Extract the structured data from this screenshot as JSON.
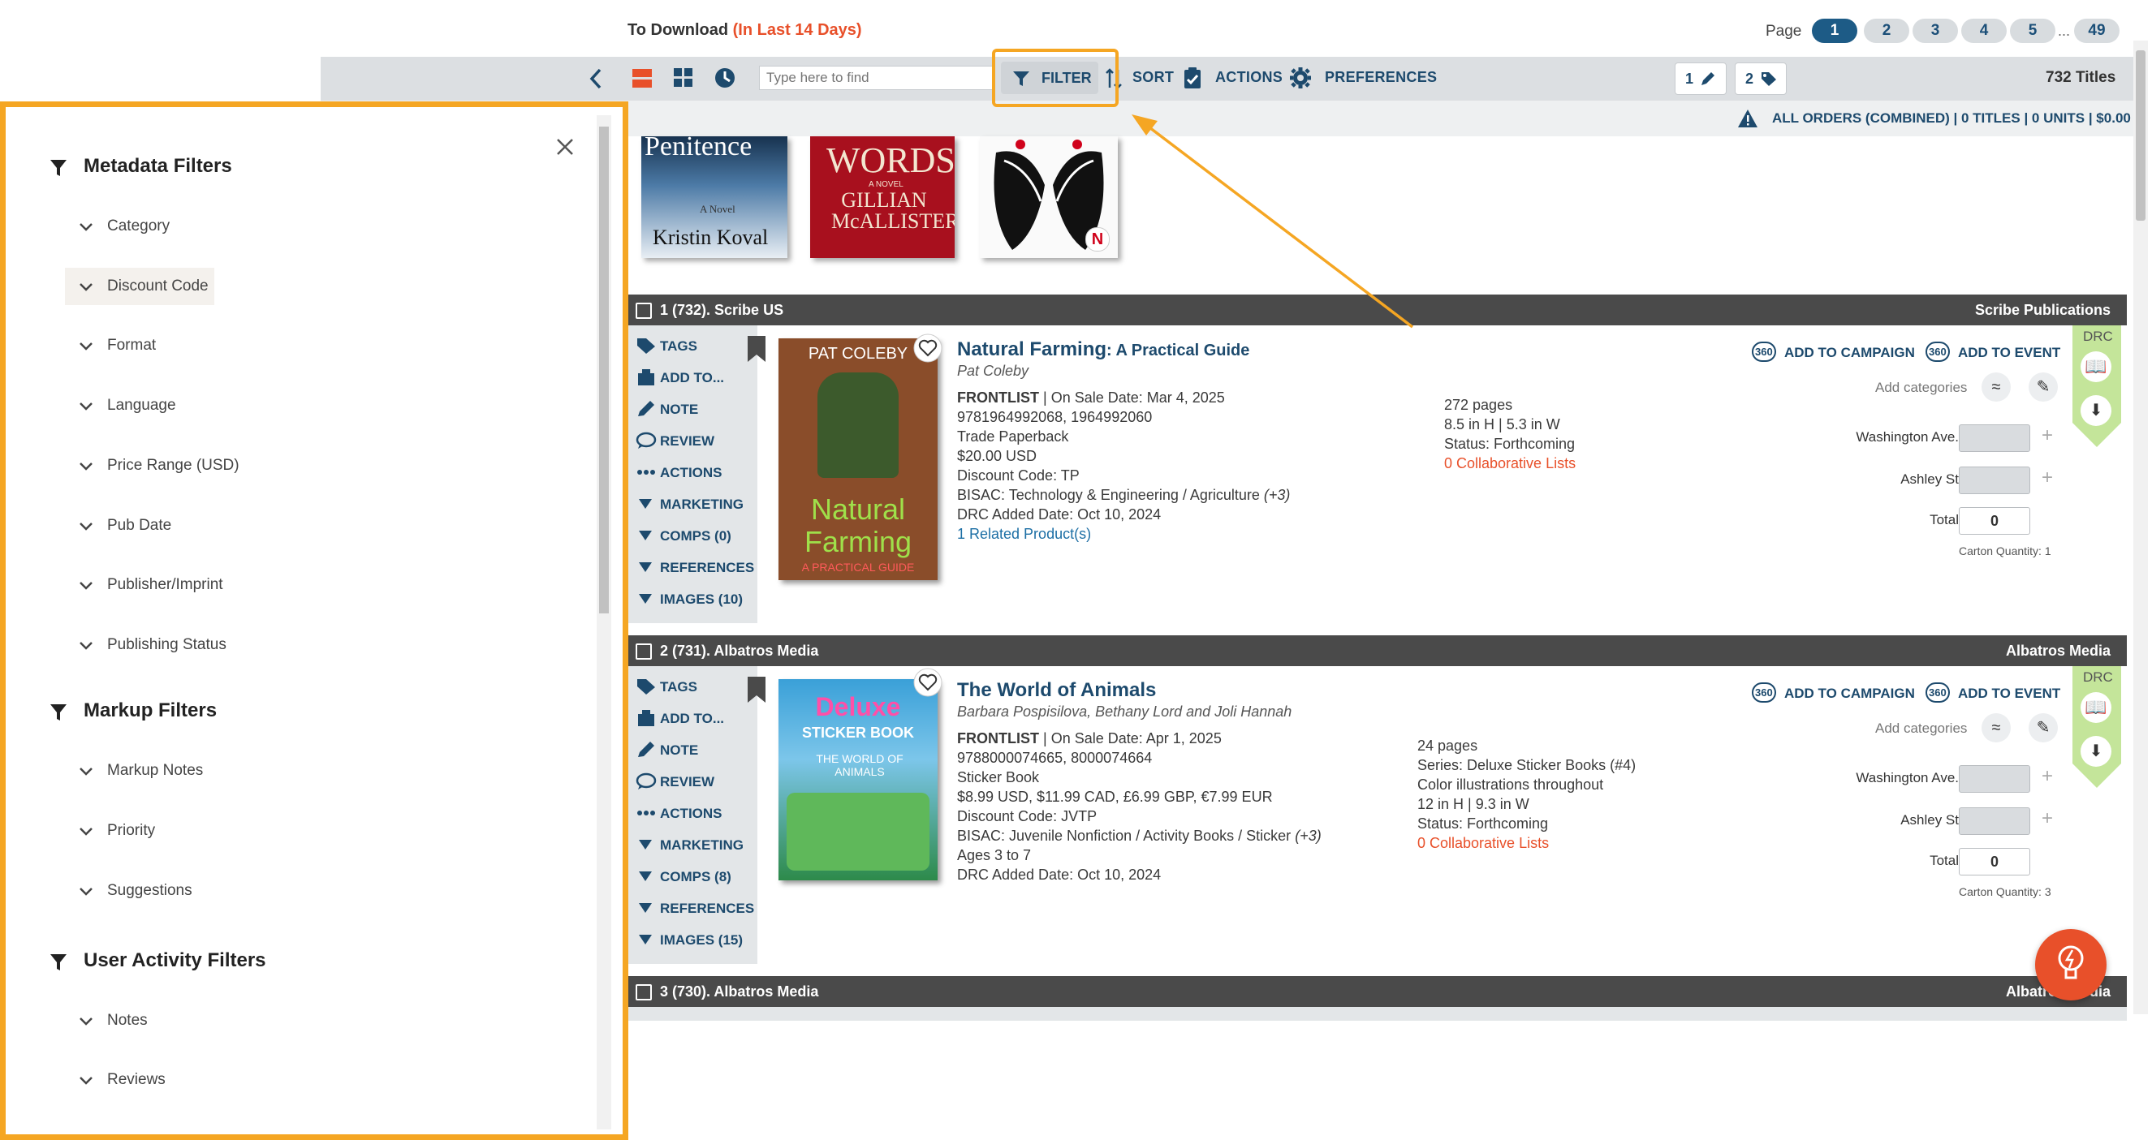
{
  "header": {
    "to_download": "To Download",
    "in_last": "(In Last 14 Days)",
    "page_label": "Page",
    "pages": [
      "1",
      "2",
      "3",
      "4",
      "5"
    ],
    "ellipsis": "...",
    "last_page": "49",
    "active_page": "1"
  },
  "toolbar": {
    "search_placeholder": "Type here to find",
    "filter": "FILTER",
    "sort": "SORT",
    "actions": "ACTIONS",
    "preferences": "PREFERENCES",
    "edit_count": "1",
    "tag_count": "2",
    "titles": "732 Titles"
  },
  "orders": {
    "text": "ALL ORDERS (COMBINED) | 0 TITLES | 0 UNITS | $0.00"
  },
  "filter_panel": {
    "metadata_title": "Metadata Filters",
    "metadata_items": [
      "Category",
      "Discount Code",
      "Format",
      "Language",
      "Price Range (USD)",
      "Pub Date",
      "Publisher/Imprint",
      "Publishing Status"
    ],
    "markup_title": "Markup Filters",
    "markup_items": [
      "Markup Notes",
      "Priority",
      "Suggestions"
    ],
    "activity_title": "User Activity Filters",
    "activity_items": [
      "Notes",
      "Reviews"
    ]
  },
  "carousel": {
    "covers": [
      {
        "title": "Penitence",
        "author": "Kristin Koval",
        "sub": "A Novel"
      },
      {
        "title": "WORDS",
        "author": "GILLIAN McALLISTER",
        "sub": "A NOVEL"
      },
      {
        "badge": "N"
      }
    ]
  },
  "side_actions": [
    "TAGS",
    "ADD TO...",
    "NOTE",
    "REVIEW",
    "ACTIONS",
    "MARKETING",
    "COMPS (0)",
    "REFERENCES",
    "IMAGES (10)"
  ],
  "side_actions_2": [
    "TAGS",
    "ADD TO...",
    "NOTE",
    "REVIEW",
    "ACTIONS",
    "MARKETING",
    "COMPS (8)",
    "REFERENCES",
    "IMAGES (15)"
  ],
  "titles": [
    {
      "header_left": "1 (732). Scribe US",
      "header_right": "Scribe Publications",
      "title": "Natural Farming",
      "subtitle": ": A Practical Guide",
      "author": "Pat Coleby",
      "cover_author": "PAT COLEBY",
      "cover_title1": "Natural",
      "cover_title2": "Farming",
      "cover_sub": "A PRACTICAL GUIDE",
      "frontlist": "FRONTLIST",
      "sale_date": "| On Sale Date: Mar 4, 2025",
      "isbn": "9781964992068, 1964992060",
      "format": "Trade Paperback",
      "price": "$20.00 USD",
      "discount": "Discount Code: TP",
      "bisac": "BISAC: Technology & Engineering / Agriculture",
      "bisac_more": "(+3)",
      "drc_date": "DRC Added Date: Oct 10, 2024",
      "related": "1 Related Product(s)",
      "right_col": [
        "272 pages",
        "8.5 in H | 5.3 in W",
        "Status: Forthcoming"
      ],
      "collab": "0 Collaborative Lists",
      "carton": "Carton Quantity: 1"
    },
    {
      "header_left": "2 (731). Albatros Media",
      "header_right": "Albatros Media",
      "title": "The World of Animals",
      "subtitle": "",
      "author": "Barbara Pospisilova, Bethany Lord and Joli Hannah",
      "cover_title1": "Deluxe",
      "cover_title2": "STICKER BOOK",
      "cover_sub": "THE WORLD OF ANIMALS",
      "frontlist": "FRONTLIST",
      "sale_date": "| On Sale Date: Apr 1, 2025",
      "isbn": "9788000074665, 8000074664",
      "format": "Sticker Book",
      "price": "$8.99 USD, $11.99 CAD, £6.99 GBP, €7.99 EUR",
      "discount": "Discount Code: JVTP",
      "bisac": "BISAC: Juvenile Nonfiction / Activity Books / Sticker",
      "bisac_more": "(+3)",
      "ages": "Ages 3 to 7",
      "drc_date": "DRC Added Date: Oct 10, 2024",
      "right_col": [
        "24 pages",
        "Series: Deluxe Sticker Books (#4)",
        "Color illustrations throughout",
        "12 in H | 9.3 in W",
        "Status: Forthcoming"
      ],
      "collab": "0 Collaborative Lists",
      "carton": "Carton Quantity: 3"
    },
    {
      "header_left": "3 (730). Albatros Media",
      "header_right": "Albatros Media"
    }
  ],
  "row_actions": {
    "add_campaign": "ADD TO CAMPAIGN",
    "add_event": "ADD TO EVENT",
    "add_categories": "Add categories",
    "drc": "DRC",
    "washington": "Washington Ave.",
    "ashley": "Ashley St",
    "total": "Total",
    "total_value": "0"
  },
  "colors": {
    "orange": "#f5a623",
    "navy": "#1d4a6d",
    "accent_red": "#e8502a",
    "drc_green": "#c4e59a"
  }
}
